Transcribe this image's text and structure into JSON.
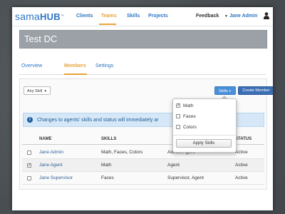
{
  "brand": {
    "logo_part1": "sama",
    "logo_part2": "HUB",
    "logo_mark": "™"
  },
  "nav": {
    "items": [
      {
        "label": "Clients",
        "active": false
      },
      {
        "label": "Teams",
        "active": true
      },
      {
        "label": "Skills",
        "active": false
      },
      {
        "label": "Projects",
        "active": false
      }
    ],
    "feedback": "Feedback",
    "user": "Jane Admin"
  },
  "page": {
    "title": "Test DC"
  },
  "subtabs": [
    {
      "label": "Overview",
      "active": false
    },
    {
      "label": "Members",
      "active": true
    },
    {
      "label": "Settings",
      "active": false
    }
  ],
  "toolbar": {
    "skill_filter": "Any Skill",
    "skills_button": "Skills",
    "create_button": "Create Member"
  },
  "info": {
    "message": "Changes to agents' skills and status will immediately ar"
  },
  "table": {
    "headers": [
      "NAME",
      "SKILLS",
      "",
      "STATUS"
    ],
    "rows": [
      {
        "checked": false,
        "name": "Jane Admin",
        "skills": "Math, Faces, Colors",
        "role": "Admin, Agent",
        "status": "Active"
      },
      {
        "checked": true,
        "name": "Jane Agent",
        "skills": "Math",
        "role": "Agent",
        "status": "Active"
      },
      {
        "checked": false,
        "name": "Jane Supervisor",
        "skills": "Faces",
        "role": "Supervisor, Agent",
        "status": "Active"
      }
    ]
  },
  "skills_dropdown": {
    "options": [
      {
        "label": "Math",
        "checked": true
      },
      {
        "label": "Faces",
        "checked": false
      },
      {
        "label": "Colors",
        "checked": false
      }
    ],
    "apply_label": "Apply Skills"
  },
  "colors": {
    "brand_blue": "#2d76c4",
    "accent_orange": "#e8a33a",
    "title_bar": "#9ba1a6",
    "info_bg": "#d6e8f7",
    "background": "#4f5559"
  }
}
